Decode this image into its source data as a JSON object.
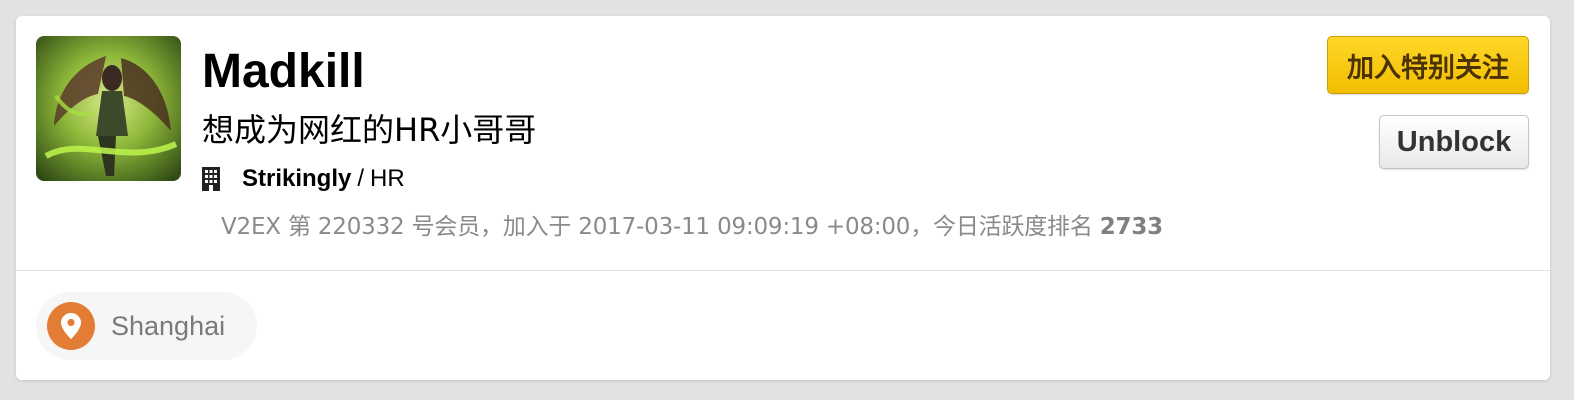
{
  "profile": {
    "username": "Madkill",
    "tagline": "想成为网红的HR小哥哥",
    "company": "Strikingly",
    "role_separator": "/",
    "role": "HR",
    "member_info_text": "V2EX 第 220332 号会员，加入于 2017-03-11 09:09:19 +08:00，今日活跃度排名 ",
    "activity_rank": "2733",
    "avatar_icon": "avatar-image"
  },
  "actions": {
    "follow_label": "加入特别关注",
    "unblock_label": "Unblock"
  },
  "location": {
    "label": "Shanghai",
    "icon": "location-pin-icon"
  },
  "colors": {
    "follow_button": "#f5c400",
    "location_icon_bg": "#e37d36",
    "meta_text": "#8a8a8a"
  }
}
